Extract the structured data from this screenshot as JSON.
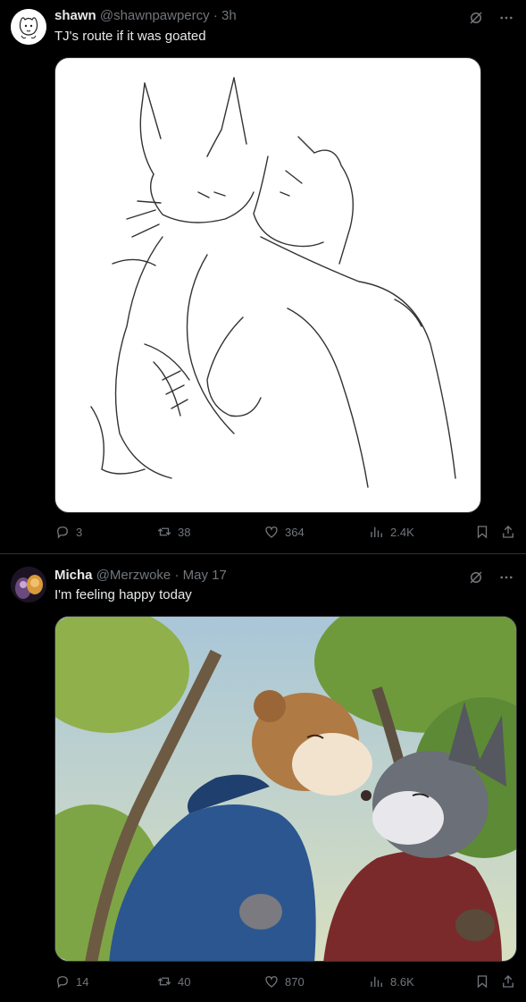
{
  "tweets": [
    {
      "author": {
        "name": "shawn",
        "handle": "@shawnpawpercy"
      },
      "separator": "·",
      "time": "3h",
      "text": "TJ's route if it was goated",
      "stats": {
        "replies": "3",
        "reposts": "38",
        "likes": "364",
        "views": "2.4K"
      },
      "icons": [
        "grok-icon",
        "more-icon",
        "reply-icon",
        "repost-icon",
        "like-icon",
        "views-icon",
        "bookmark-icon",
        "share-icon"
      ]
    },
    {
      "author": {
        "name": "Micha",
        "handle": "@Merzwoke"
      },
      "separator": "·",
      "time": "May 17",
      "text": "I'm feeling happy today",
      "stats": {
        "replies": "14",
        "reposts": "40",
        "likes": "870",
        "views": "8.6K"
      },
      "icons": [
        "grok-icon",
        "more-icon",
        "reply-icon",
        "repost-icon",
        "like-icon",
        "views-icon",
        "bookmark-icon",
        "share-icon"
      ]
    }
  ],
  "colors": {
    "background": "#000000",
    "text": "#e7e9ea",
    "muted": "#71767b",
    "divider": "#2f3336"
  }
}
